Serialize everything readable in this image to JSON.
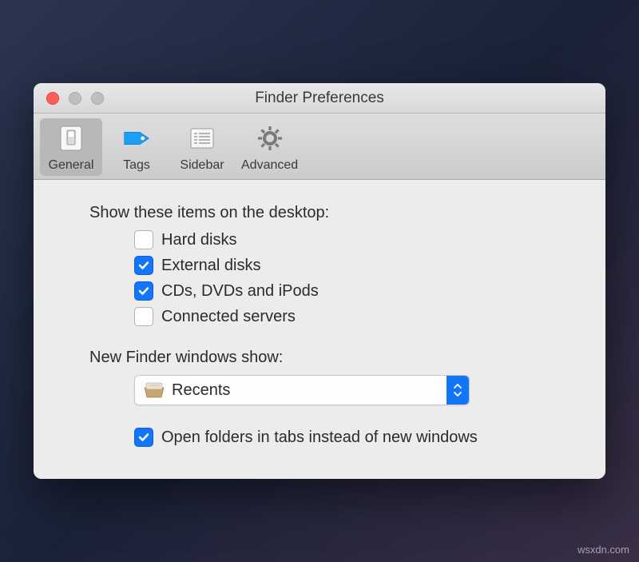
{
  "window": {
    "title": "Finder Preferences"
  },
  "toolbar": {
    "items": [
      {
        "label": "General",
        "icon": "switch-icon",
        "selected": true
      },
      {
        "label": "Tags",
        "icon": "tag-icon",
        "selected": false
      },
      {
        "label": "Sidebar",
        "icon": "list-icon",
        "selected": false
      },
      {
        "label": "Advanced",
        "icon": "gear-icon",
        "selected": false
      }
    ]
  },
  "sections": {
    "desktop_items": {
      "label": "Show these items on the desktop:",
      "options": [
        {
          "label": "Hard disks",
          "checked": false
        },
        {
          "label": "External disks",
          "checked": true
        },
        {
          "label": "CDs, DVDs and iPods",
          "checked": true
        },
        {
          "label": "Connected servers",
          "checked": false
        }
      ]
    },
    "new_windows": {
      "label": "New Finder windows show:",
      "selected": "Recents"
    },
    "open_in_tabs": {
      "label": "Open folders in tabs instead of new windows",
      "checked": true
    }
  },
  "watermark": "wsxdn.com"
}
